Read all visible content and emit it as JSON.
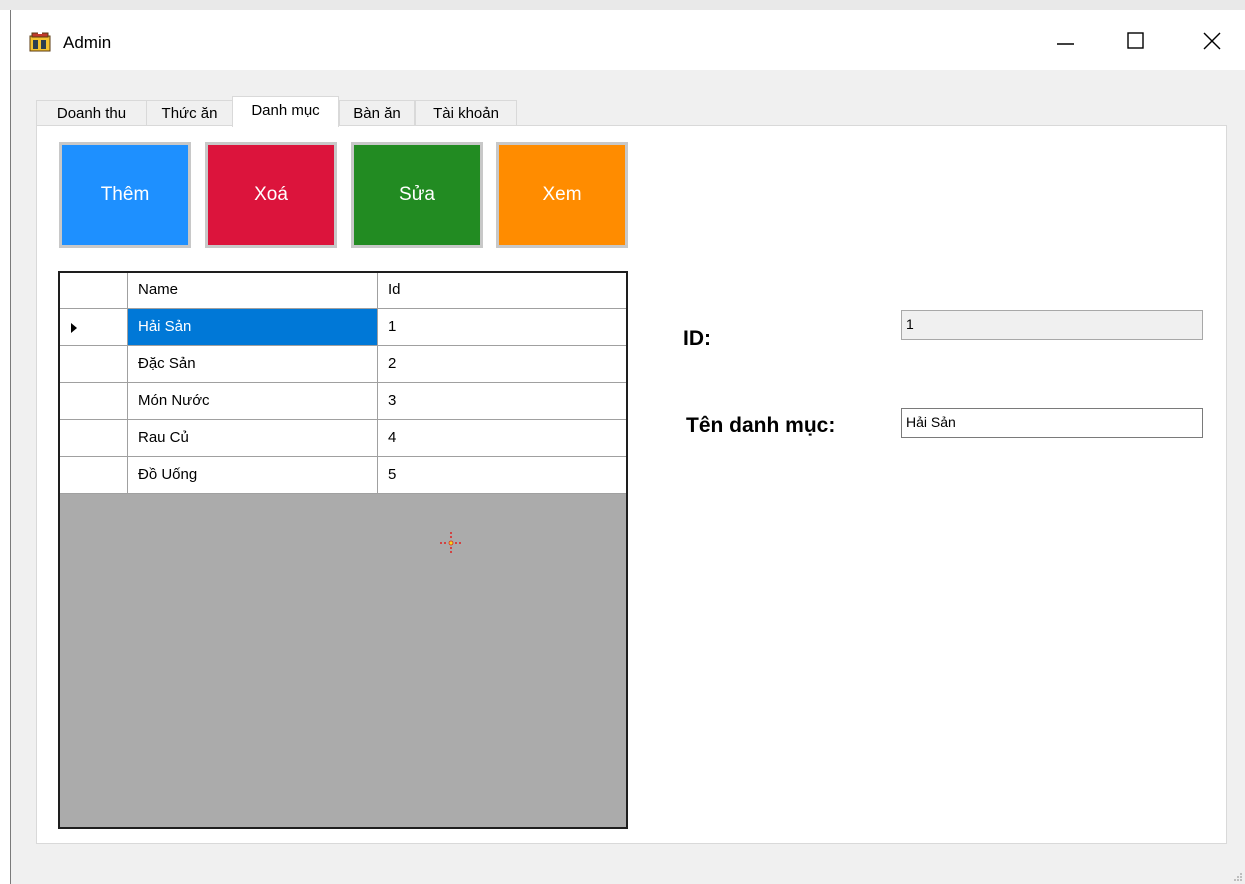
{
  "window": {
    "title": "Admin",
    "controls": [
      "minimize",
      "maximize",
      "close"
    ]
  },
  "tabs": [
    {
      "label": "Doanh thu",
      "active": false
    },
    {
      "label": "Thức ăn",
      "active": false
    },
    {
      "label": "Danh mục",
      "active": true
    },
    {
      "label": "Bàn ăn",
      "active": false
    },
    {
      "label": "Tài khoản",
      "active": false
    }
  ],
  "actions": [
    {
      "label": "Thêm",
      "color": "#1e90ff"
    },
    {
      "label": "Xoá",
      "color": "#dc143c"
    },
    {
      "label": "Sửa",
      "color": "#228b22"
    },
    {
      "label": "Xem",
      "color": "#ff8c00"
    }
  ],
  "grid": {
    "columns": [
      "Name",
      "Id"
    ],
    "rows": [
      {
        "name": "Hải Sản",
        "id": "1",
        "selected": true
      },
      {
        "name": "Đặc Sản",
        "id": "2",
        "selected": false
      },
      {
        "name": "Món Nước",
        "id": "3",
        "selected": false
      },
      {
        "name": "Rau Củ",
        "id": "4",
        "selected": false
      },
      {
        "name": "Đồ Uống",
        "id": "5",
        "selected": false
      }
    ]
  },
  "form": {
    "id_label": "ID:",
    "id_value": "1",
    "name_label": "Tên danh mục:",
    "name_value": "Hải Sản"
  },
  "colors": {
    "selection": "#0078d7",
    "grid_empty": "#ababab"
  }
}
